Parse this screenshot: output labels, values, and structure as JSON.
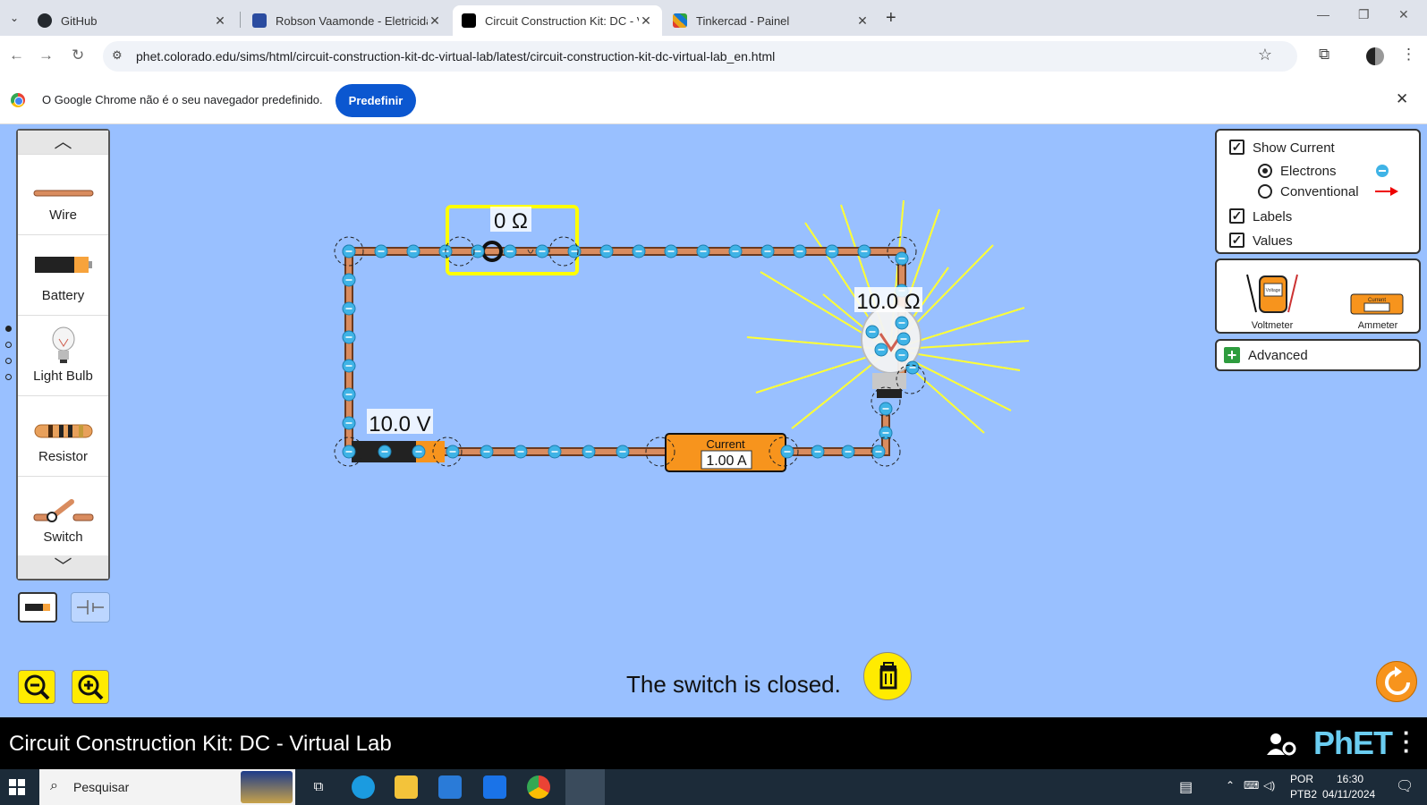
{
  "browser": {
    "tabs": [
      {
        "title": "GitHub",
        "active": false
      },
      {
        "title": "Robson Vaamonde - Eletricidad",
        "active": false
      },
      {
        "title": "Circuit Construction Kit: DC - Vi",
        "active": true
      },
      {
        "title": "Tinkercad - Painel",
        "active": false
      }
    ],
    "url": "phet.colorado.edu/sims/html/circuit-construction-kit-dc-virtual-lab/latest/circuit-construction-kit-dc-virtual-lab_en.html"
  },
  "infobar": {
    "message": "O Google Chrome não é o seu navegador predefinido.",
    "button": "Predefinir"
  },
  "carousel": {
    "items": [
      {
        "label": "Wire",
        "icon": "wire-icon"
      },
      {
        "label": "Battery",
        "icon": "battery-icon"
      },
      {
        "label": "Light Bulb",
        "icon": "light-bulb-icon"
      },
      {
        "label": "Resistor",
        "icon": "resistor-icon"
      },
      {
        "label": "Switch",
        "icon": "switch-icon"
      }
    ],
    "page_dots": 4,
    "active_dot": 0
  },
  "circuit": {
    "switch_resistance": "0 Ω",
    "bulb_resistance": "10.0 Ω",
    "battery_voltage": "10.0 V",
    "ammeter_title": "Current",
    "ammeter_reading": "1.00 A"
  },
  "controls": {
    "show_current": "Show Current",
    "show_current_checked": true,
    "electrons": "Electrons",
    "electrons_selected": true,
    "conventional": "Conventional",
    "labels": "Labels",
    "labels_checked": true,
    "values": "Values",
    "values_checked": true,
    "voltmeter": "Voltmeter",
    "voltmeter_face": "Voltage",
    "ammeter": "Ammeter",
    "ammeter_face": "Current",
    "advanced": "Advanced"
  },
  "status_text": "The switch is closed.",
  "sim_title": "Circuit Construction Kit: DC - Virtual Lab",
  "phet_logo": "PhET",
  "taskbar": {
    "search_label": "Pesquisar",
    "lang": "POR",
    "layout": "PTB2",
    "time": "16:30",
    "date": "04/11/2024"
  },
  "colors": {
    "sim_bg": "#99c0ff",
    "highlight": "#ffff00",
    "electron": "#3fb3e6",
    "wire": "#d98c5f",
    "ammeter": "#f7941d"
  }
}
